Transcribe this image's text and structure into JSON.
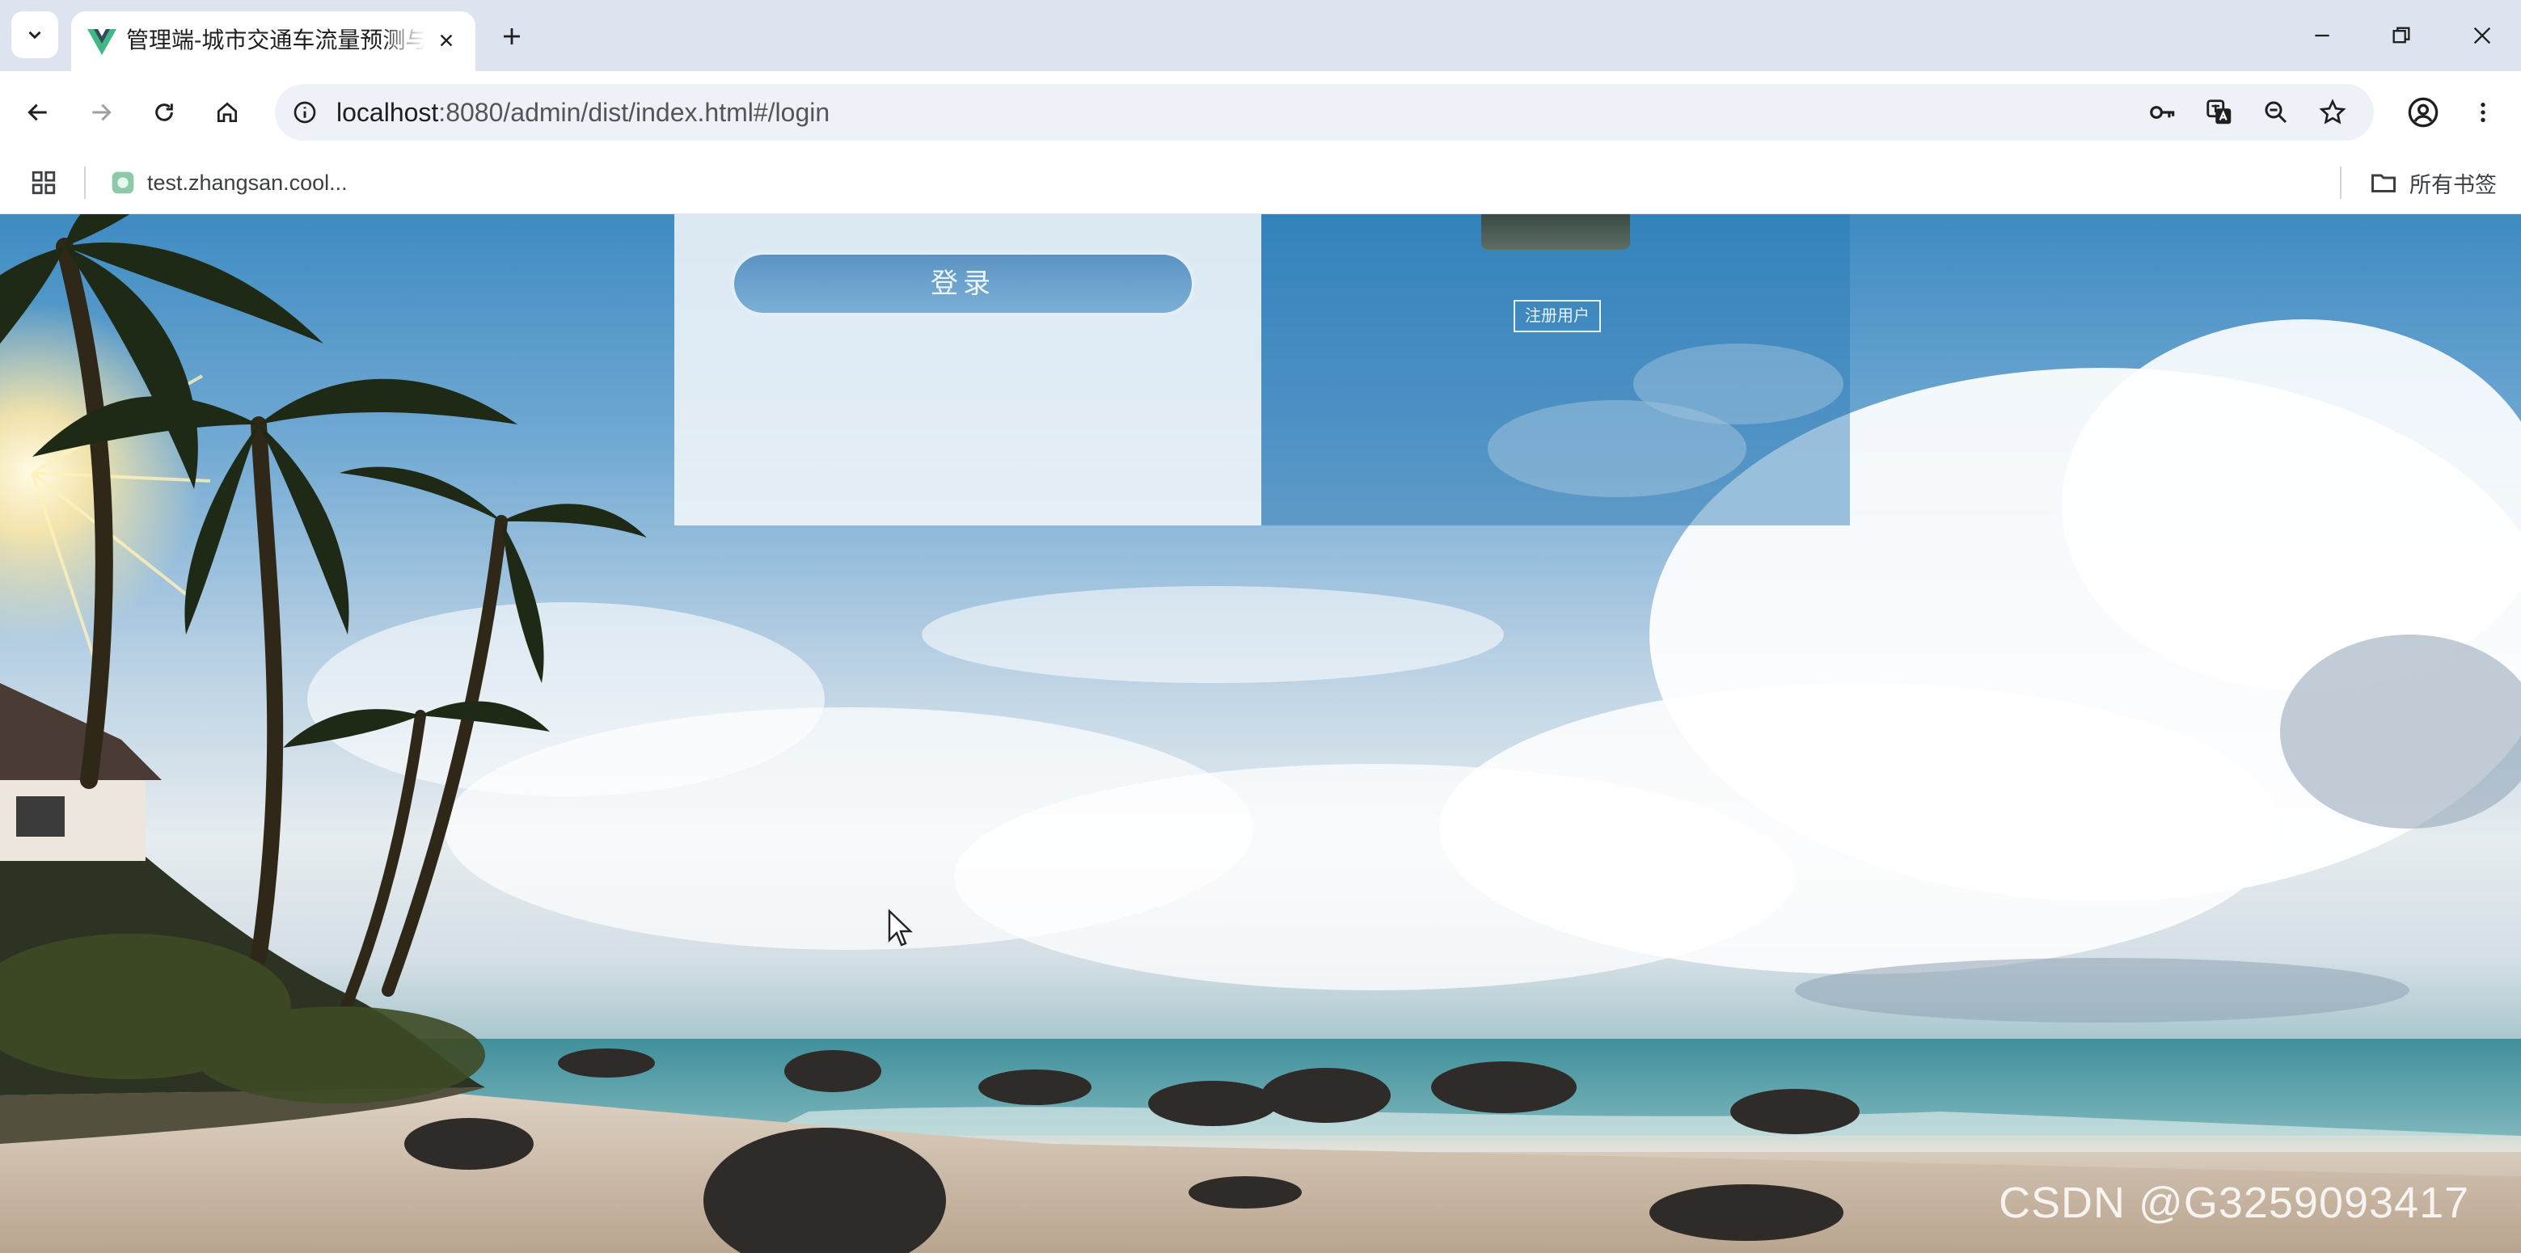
{
  "browser": {
    "tab_title": "管理端-城市交通车流量预测与排",
    "url_host": "localhost",
    "url_rest": ":8080/admin/dist/index.html#/login",
    "bookmark_label": "test.zhangsan.cool...",
    "all_bookmarks_label": "所有书签",
    "icons": {
      "tab_list": "chevron-down-icon",
      "favicon": "vue-logo-icon",
      "tab_close": "close-icon",
      "new_tab": "plus-icon",
      "minimize": "minimize-icon",
      "restore": "restore-icon",
      "close_window": "close-icon",
      "back": "arrow-left-icon",
      "forward": "arrow-right-icon",
      "reload": "reload-icon",
      "home": "home-icon",
      "site_info": "info-icon",
      "password": "key-icon",
      "translate": "translate-icon",
      "zoom": "zoom-out-icon",
      "bookmark_star": "star-icon",
      "profile": "account-icon",
      "menu": "more-vert-icon",
      "apps": "apps-grid-icon",
      "folder": "folder-icon"
    },
    "colors": {
      "tab_strip": "#dde3ef",
      "favicon_green": "#41b883",
      "favicon_dark": "#35495e"
    }
  },
  "page": {
    "login_button_label": "登录",
    "register_button_label": "注册用户",
    "watermark": "CSDN @G3259093417",
    "colors": {
      "login_button": "#5d93c3",
      "right_panel": "#2878b4"
    }
  }
}
